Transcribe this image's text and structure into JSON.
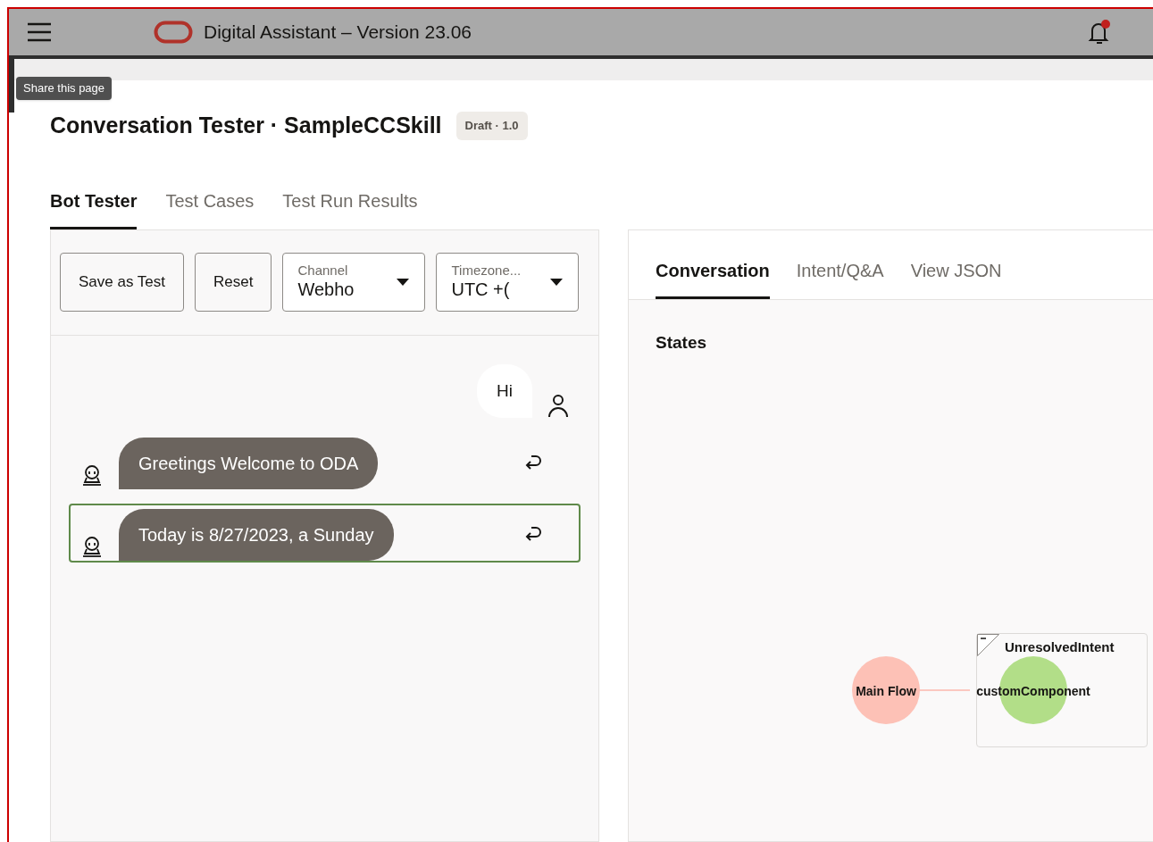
{
  "header": {
    "title": "Digital Assistant – Version 23.06",
    "notification": true
  },
  "tooltip": "Share this page",
  "page": {
    "title": "Conversation Tester · SampleCCSkill",
    "badge": "Draft · 1.0"
  },
  "tabs": [
    {
      "label": "Bot Tester",
      "selected": true
    },
    {
      "label": "Test Cases",
      "selected": false
    },
    {
      "label": "Test Run Results",
      "selected": false
    }
  ],
  "toolbar": {
    "buttons": [
      "Save as Test",
      "Reset"
    ],
    "dropdowns": [
      {
        "label": "Channel",
        "value": "Webho"
      },
      {
        "label": "Timezone...",
        "value": "UTC +("
      }
    ]
  },
  "messages": [
    {
      "kind": "user",
      "text": "Hi",
      "selected": false
    },
    {
      "kind": "bot",
      "text": "Greetings Welcome to ODA",
      "selected": false
    },
    {
      "kind": "bot",
      "text": "Today is 8/27/2023, a Sunday",
      "selected": true
    }
  ],
  "right_tabs": [
    {
      "label": "Conversation",
      "selected": true
    },
    {
      "label": "Intent/Q&A",
      "selected": false
    },
    {
      "label": "View JSON",
      "selected": false
    }
  ],
  "states": {
    "heading": "States",
    "flow": "Main Flow",
    "group": "UnresolvedIntent",
    "component": "customComponent"
  }
}
